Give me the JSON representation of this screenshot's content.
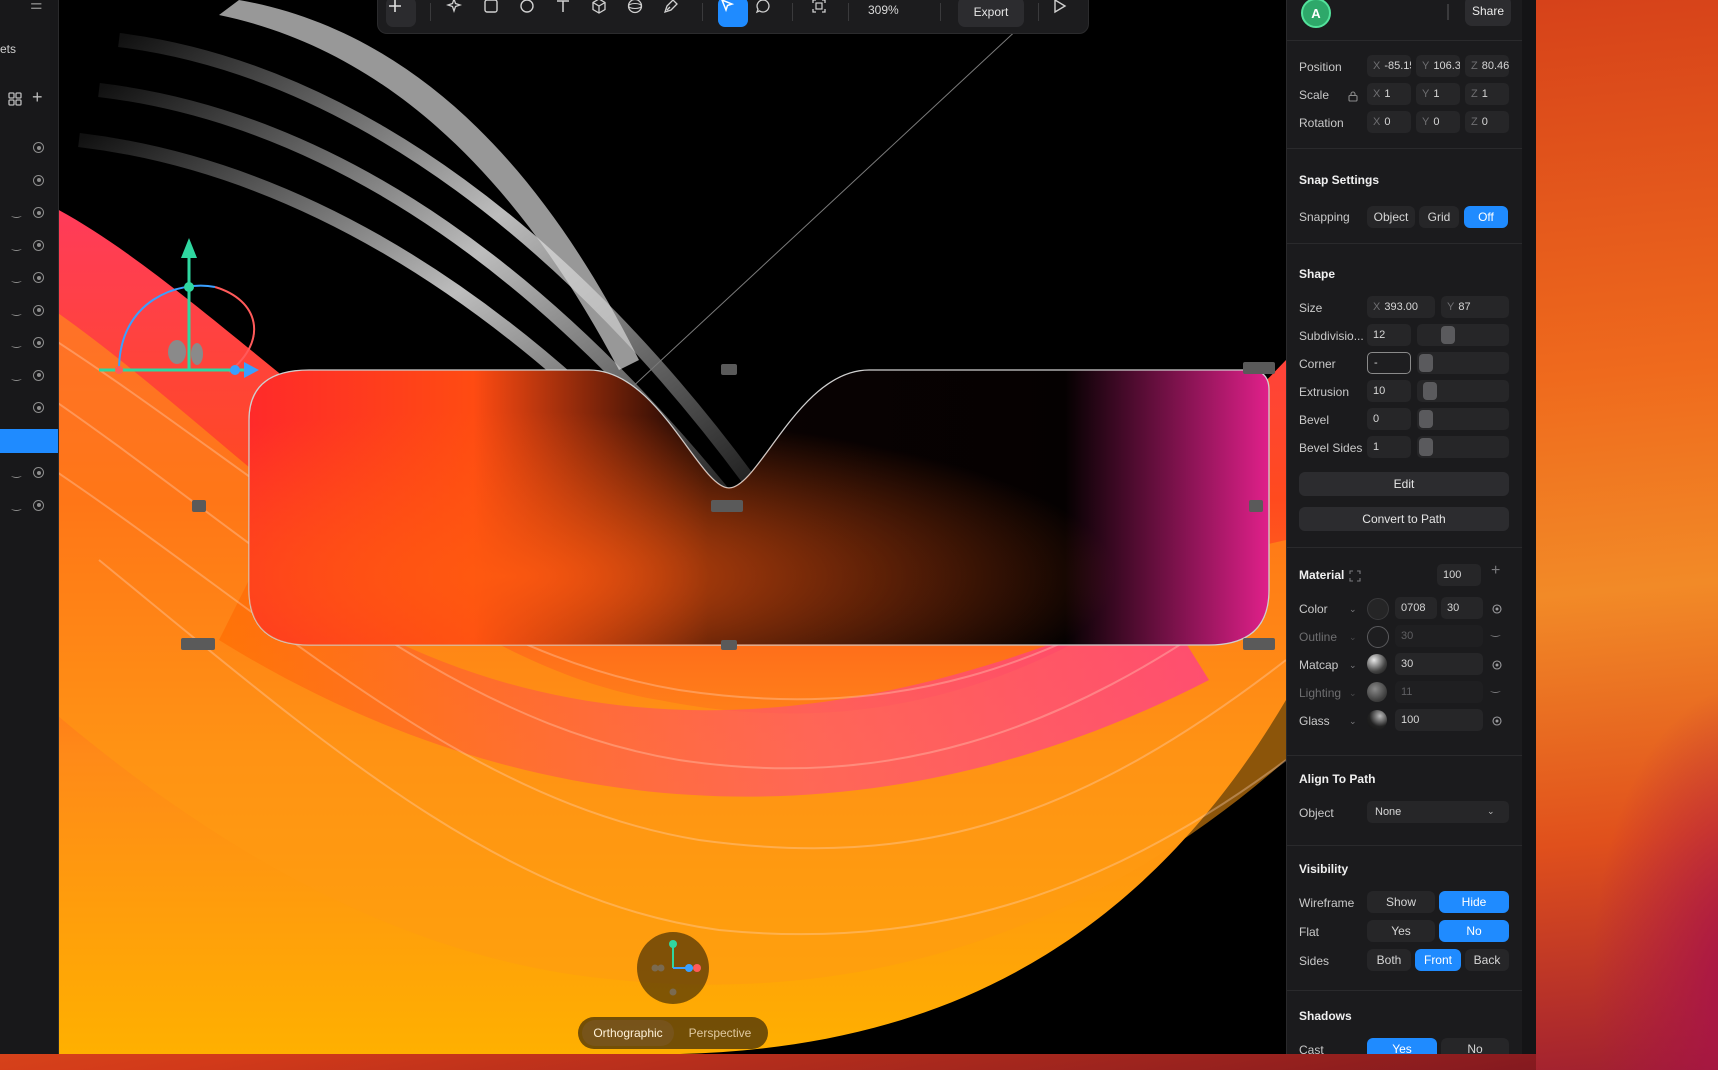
{
  "left_sidebar": {
    "assets_label": "ets",
    "layers": [
      {
        "curve": false
      },
      {
        "curve": false
      },
      {
        "curve": true
      },
      {
        "curve": true
      },
      {
        "curve": true
      },
      {
        "curve": true
      },
      {
        "curve": true
      },
      {
        "curve": true
      },
      {
        "curve": false
      },
      {
        "curve": false,
        "selected": true
      },
      {
        "curve": true
      },
      {
        "curve": true
      }
    ]
  },
  "toolbar": {
    "zoom": "309%",
    "export_label": "Export",
    "active_tool": "select-tool"
  },
  "camera": {
    "orthographic_label": "Orthographic",
    "perspective_label": "Perspective",
    "active": "orthographic"
  },
  "header": {
    "avatar_letter": "A",
    "share_label": "Share"
  },
  "transform": {
    "position_label": "Position",
    "position": {
      "x": "-85.15",
      "y": "106.3",
      "z": "80.46"
    },
    "scale_label": "Scale",
    "scale": {
      "x": "1",
      "y": "1",
      "z": "1"
    },
    "rotation_label": "Rotation",
    "rotation": {
      "x": "0",
      "y": "0",
      "z": "0"
    },
    "axis": {
      "x": "X",
      "y": "Y",
      "z": "Z"
    }
  },
  "snap": {
    "title": "Snap Settings",
    "label": "Snapping",
    "options": [
      "Object",
      "Grid",
      "Off"
    ],
    "selected": "Off"
  },
  "shape": {
    "title": "Shape",
    "size_label": "Size",
    "size_x": "393.00",
    "size_y": "87",
    "subdivisions_label": "Subdivisio...",
    "subdivisions": "12",
    "corner_label": "Corner",
    "corner": "-",
    "extrusion_label": "Extrusion",
    "extrusion": "10",
    "bevel_label": "Bevel",
    "bevel": "0",
    "bevel_sides_label": "Bevel Sides",
    "bevel_sides": "1",
    "edit_label": "Edit",
    "convert_label": "Convert to Path"
  },
  "material": {
    "title": "Material",
    "opacity": "100",
    "color_label": "Color",
    "color_hex": "0708",
    "color_value": "30",
    "outline_label": "Outline",
    "outline_value": "30",
    "matcap_label": "Matcap",
    "matcap_value": "30",
    "lighting_label": "Lighting",
    "lighting_value": "11",
    "glass_label": "Glass",
    "glass_value": "100"
  },
  "align": {
    "title": "Align To Path",
    "object_label": "Object",
    "object_value": "None"
  },
  "visibility": {
    "title": "Visibility",
    "wireframe_label": "Wireframe",
    "wireframe_options": [
      "Show",
      "Hide"
    ],
    "wireframe_selected": "Hide",
    "flat_label": "Flat",
    "flat_options": [
      "Yes",
      "No"
    ],
    "flat_selected": "No",
    "sides_label": "Sides",
    "sides_options": [
      "Both",
      "Front",
      "Back"
    ],
    "sides_selected": "Front"
  },
  "shadows": {
    "title": "Shadows",
    "cast_label": "Cast",
    "cast_options": [
      "Yes",
      "No"
    ],
    "cast_selected": "Yes"
  },
  "colors": {
    "accent": "#1f8bff",
    "panel_bg": "#1b1b1d",
    "avatar": "#2ea86a"
  }
}
